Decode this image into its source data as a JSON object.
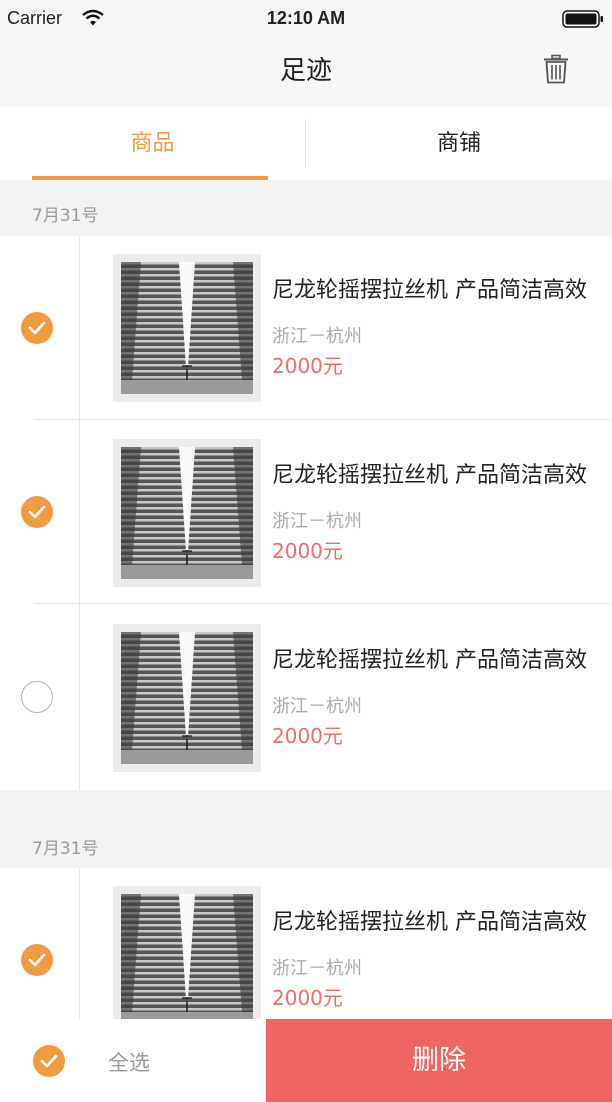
{
  "status": {
    "carrier": "Carrier",
    "time": "12:10 AM"
  },
  "nav": {
    "title": "足迹"
  },
  "tabs": [
    {
      "label": "商品"
    },
    {
      "label": "商铺"
    }
  ],
  "groups": [
    {
      "date": "7月31号",
      "items": [
        {
          "title": "尼龙轮摇摆拉丝机 产品简洁高效",
          "location": "浙江－杭州",
          "price": "2000元",
          "checked": true
        },
        {
          "title": "尼龙轮摇摆拉丝机 产品简洁高效",
          "location": "浙江－杭州",
          "price": "2000元",
          "checked": true
        },
        {
          "title": "尼龙轮摇摆拉丝机 产品简洁高效",
          "location": "浙江－杭州",
          "price": "2000元",
          "checked": false
        }
      ]
    },
    {
      "date": "7月31号",
      "items": [
        {
          "title": "尼龙轮摇摆拉丝机 产品简洁高效",
          "location": "浙江－杭州",
          "price": "2000元",
          "checked": true
        }
      ]
    }
  ],
  "bottom": {
    "select_all": "全选",
    "delete": "删除"
  },
  "colors": {
    "accent": "#f29a3f",
    "price": "#ea6e6a",
    "delete_bg": "#ee6561"
  },
  "icons": {
    "trash": "trash-icon",
    "check": "checkmark-icon",
    "wifi": "wifi-icon",
    "battery": "battery-icon"
  }
}
